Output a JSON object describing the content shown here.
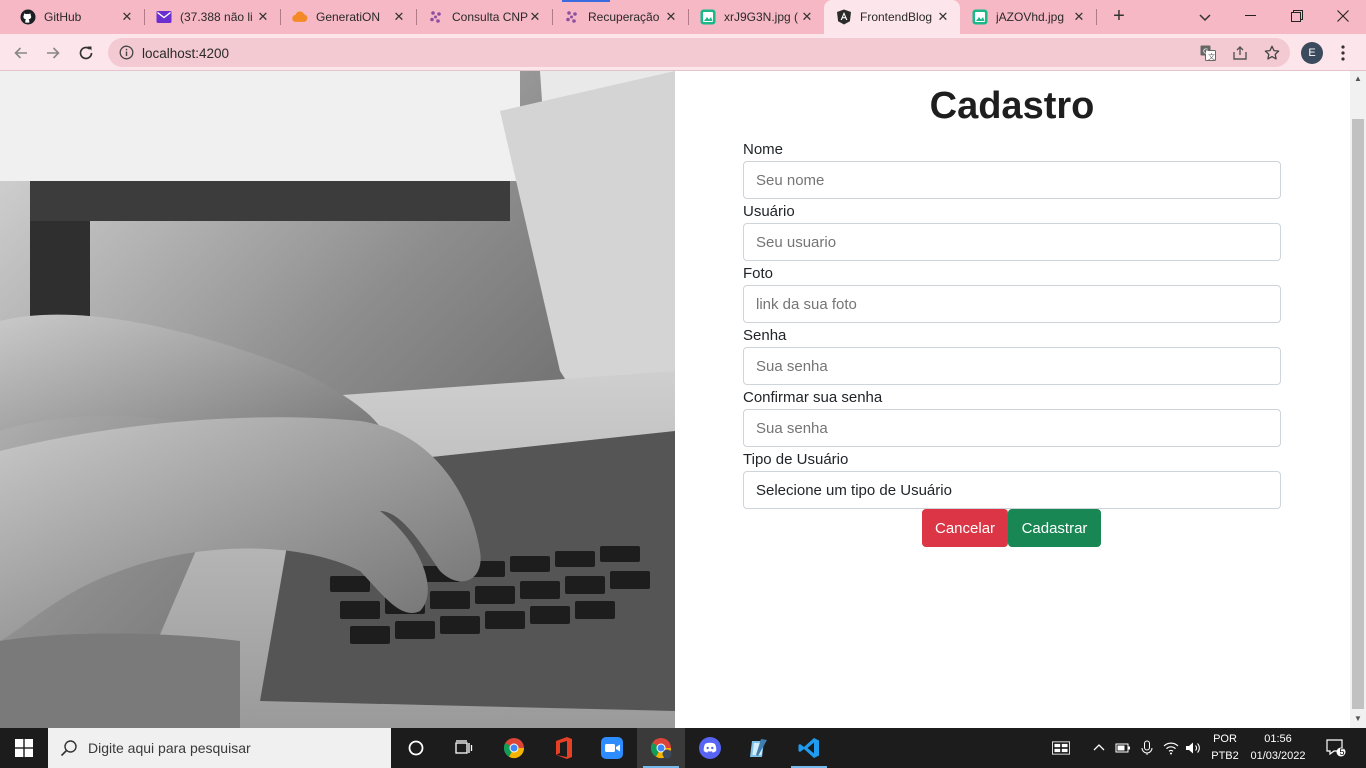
{
  "browser": {
    "tabs": [
      {
        "title": "GitHub",
        "icon": "github-icon",
        "active": false
      },
      {
        "title": "(37.388 não li",
        "icon": "mail-icon",
        "active": false
      },
      {
        "title": "GeneratiON",
        "icon": "cloud-icon",
        "active": false
      },
      {
        "title": "Consulta CNP",
        "icon": "slack-icon",
        "active": false
      },
      {
        "title": "Recuperação",
        "icon": "slack-icon",
        "active": false
      },
      {
        "title": "xrJ9G3N.jpg (",
        "icon": "image-icon",
        "active": false
      },
      {
        "title": "FrontendBlog",
        "icon": "angular-icon",
        "active": true
      },
      {
        "title": "jAZOVhd.jpg",
        "icon": "image-icon",
        "active": false
      }
    ],
    "url": "localhost:4200",
    "profile_initial": "E"
  },
  "form": {
    "title": "Cadastro",
    "fields": [
      {
        "label": "Nome",
        "placeholder": "Seu nome"
      },
      {
        "label": "Usuário",
        "placeholder": "Seu usuario"
      },
      {
        "label": "Foto",
        "placeholder": "link da sua foto"
      },
      {
        "label": "Senha",
        "placeholder": "Sua senha"
      },
      {
        "label": "Confirmar sua senha",
        "placeholder": "Sua senha"
      }
    ],
    "user_type": {
      "label": "Tipo de Usuário",
      "selected": "Selecione um tipo de Usuário"
    },
    "cancel_label": "Cancelar",
    "submit_label": "Cadastrar"
  },
  "taskbar": {
    "search_placeholder": "Digite aqui para pesquisar",
    "language": "POR",
    "keyboard": "PTB2",
    "time": "01:56",
    "date": "01/03/2022",
    "notifications": "5"
  },
  "colors": {
    "tab_strip": "#f5b8c4",
    "toolbar": "#fde6eb",
    "cancel": "#dc3545",
    "submit": "#198754"
  }
}
